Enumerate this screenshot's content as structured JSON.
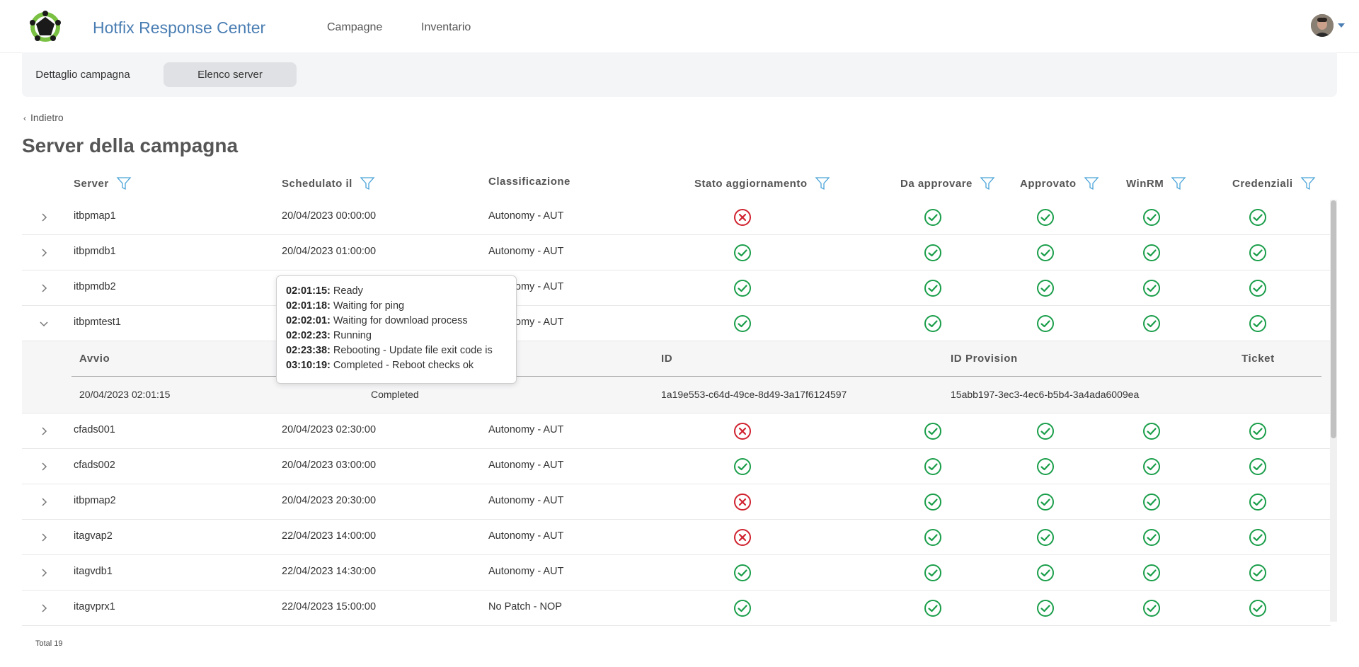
{
  "header": {
    "app_title": "Hotfix Response Center",
    "nav": [
      "Campagne",
      "Inventario"
    ]
  },
  "tabs": [
    {
      "label": "Dettaglio campagna",
      "active": false
    },
    {
      "label": "Elenco server",
      "active": true
    }
  ],
  "back_label": "Indietro",
  "page_title": "Server della campagna",
  "columns": {
    "server": "Server",
    "scheduled": "Schedulato il",
    "classification": "Classificazione",
    "update_status": "Stato aggiornamento",
    "to_approve": "Da approvare",
    "approved": "Approvato",
    "winrm": "WinRM",
    "credentials": "Credenziali"
  },
  "rows": [
    {
      "server": "itbpmap1",
      "scheduled": "20/04/2023 00:00:00",
      "classification": "Autonomy - AUT",
      "update_status": "error",
      "to_approve": "ok",
      "approved": "ok",
      "winrm": "ok",
      "credentials": "ok"
    },
    {
      "server": "itbpmdb1",
      "scheduled": "20/04/2023 01:00:00",
      "classification": "Autonomy - AUT",
      "update_status": "ok",
      "to_approve": "ok",
      "approved": "ok",
      "winrm": "ok",
      "credentials": "ok"
    },
    {
      "server": "itbpmdb2",
      "scheduled": "",
      "classification": "Autonomy - AUT",
      "update_status": "ok",
      "to_approve": "ok",
      "approved": "ok",
      "winrm": "ok",
      "credentials": "ok"
    },
    {
      "server": "itbpmtest1",
      "scheduled": "",
      "classification": "Autonomy - AUT",
      "update_status": "ok",
      "to_approve": "ok",
      "approved": "ok",
      "winrm": "ok",
      "credentials": "ok",
      "expanded": true
    },
    {
      "server": "cfads001",
      "scheduled": "20/04/2023 02:30:00",
      "classification": "Autonomy - AUT",
      "update_status": "error",
      "to_approve": "ok",
      "approved": "ok",
      "winrm": "ok",
      "credentials": "ok"
    },
    {
      "server": "cfads002",
      "scheduled": "20/04/2023 03:00:00",
      "classification": "Autonomy - AUT",
      "update_status": "ok",
      "to_approve": "ok",
      "approved": "ok",
      "winrm": "ok",
      "credentials": "ok"
    },
    {
      "server": "itbpmap2",
      "scheduled": "20/04/2023 20:30:00",
      "classification": "Autonomy - AUT",
      "update_status": "error",
      "to_approve": "ok",
      "approved": "ok",
      "winrm": "ok",
      "credentials": "ok"
    },
    {
      "server": "itagvap2",
      "scheduled": "22/04/2023 14:00:00",
      "classification": "Autonomy - AUT",
      "update_status": "error",
      "to_approve": "ok",
      "approved": "ok",
      "winrm": "ok",
      "credentials": "ok"
    },
    {
      "server": "itagvdb1",
      "scheduled": "22/04/2023 14:30:00",
      "classification": "Autonomy - AUT",
      "update_status": "ok",
      "to_approve": "ok",
      "approved": "ok",
      "winrm": "ok",
      "credentials": "ok"
    },
    {
      "server": "itagvprx1",
      "scheduled": "22/04/2023 15:00:00",
      "classification": "No Patch - NOP",
      "update_status": "ok",
      "to_approve": "ok",
      "approved": "ok",
      "winrm": "ok",
      "credentials": "ok"
    }
  ],
  "detail": {
    "headers": {
      "start": "Avvio",
      "id": "ID",
      "id_provision": "ID Provision",
      "ticket": "Ticket"
    },
    "start": "20/04/2023 02:01:15",
    "status": "Completed",
    "id": "1a19e553-c64d-49ce-8d49-3a17f6124597",
    "id_provision": "15abb197-3ec3-4ec6-b5b4-3a4ada6009ea",
    "ticket": ""
  },
  "tooltip": [
    {
      "time": "02:01:15:",
      "text": " Ready"
    },
    {
      "time": "02:01:18:",
      "text": " Waiting for ping"
    },
    {
      "time": "02:02:01:",
      "text": " Waiting for download process"
    },
    {
      "time": "02:02:23:",
      "text": " Running"
    },
    {
      "time": "02:23:38:",
      "text": " Rebooting - Update file exit code is"
    },
    {
      "time": "03:10:19:",
      "text": " Completed - Reboot checks ok"
    }
  ],
  "total_label": "Total 19",
  "colors": {
    "ok": "#1a9e4a",
    "error": "#d0222e",
    "title_blue": "#4a7eb3"
  }
}
